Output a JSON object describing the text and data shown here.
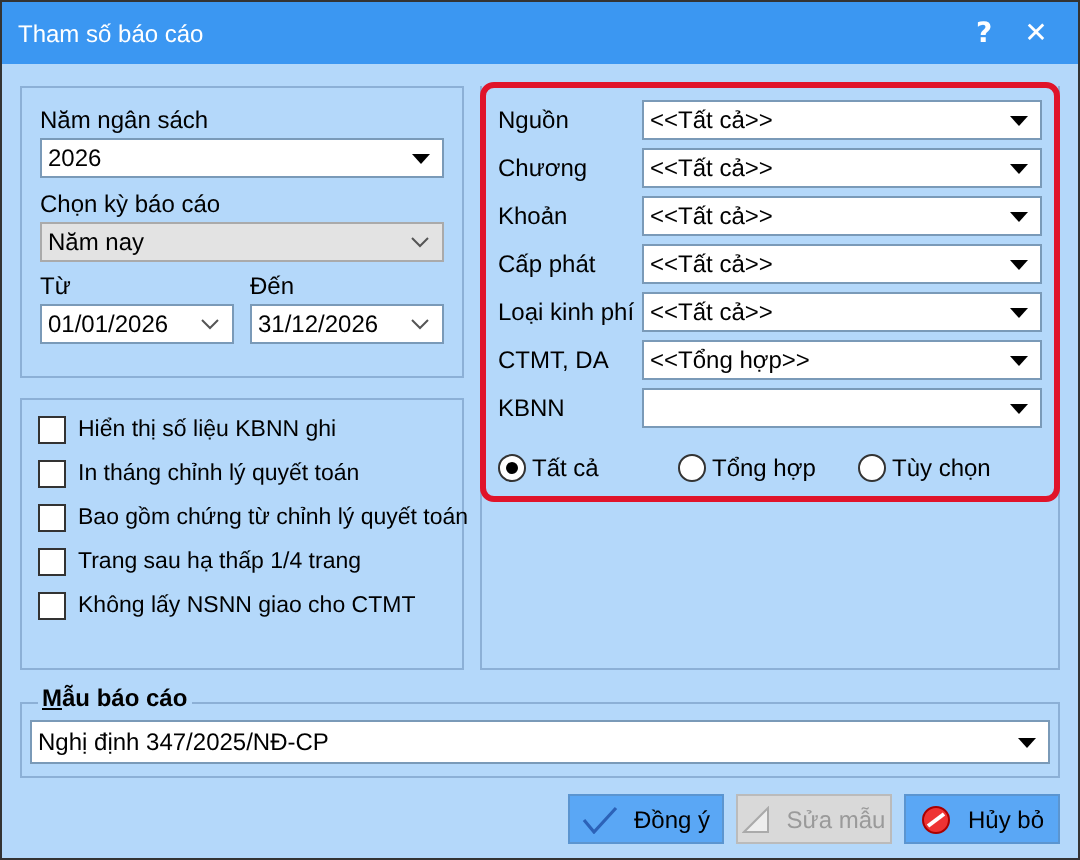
{
  "window": {
    "title": "Tham số báo cáo",
    "help": "?",
    "close": "✕"
  },
  "period": {
    "year_label": "Năm ngân sách",
    "year": "2026",
    "period_label": "Chọn kỳ báo cáo",
    "period": "Năm nay",
    "period_disabled": true,
    "from_label": "Từ",
    "from": "01/01/2026",
    "to_label": "Đến",
    "to": "31/12/2026"
  },
  "options": [
    {
      "label": "Hiển thị số liệu KBNN ghi",
      "checked": false
    },
    {
      "label": "In tháng chỉnh lý quyết toán",
      "checked": false
    },
    {
      "label": "Bao gồm chứng từ chỉnh lý quyết toán",
      "checked": false
    },
    {
      "label": "Trang sau hạ thấp 1/4 trang",
      "checked": false
    },
    {
      "label": "Không lấy NSNN giao cho CTMT",
      "checked": false
    }
  ],
  "filters": [
    {
      "label": "Nguồn",
      "value": "<<Tất cả>>"
    },
    {
      "label": "Chương",
      "value": "<<Tất cả>>"
    },
    {
      "label": "Khoản",
      "value": "<<Tất cả>>"
    },
    {
      "label": "Cấp phát",
      "value": "<<Tất cả>>"
    },
    {
      "label": "Loại kinh phí",
      "value": "<<Tất cả>>"
    },
    {
      "label": "CTMT, DA",
      "value": "<<Tổng hợp>>"
    },
    {
      "label": "KBNN"
    }
  ],
  "modes": [
    {
      "label": "Tất cả",
      "selected": true
    },
    {
      "label": "Tổng hợp",
      "selected": false
    },
    {
      "label": "Tùy chọn",
      "selected": false
    }
  ],
  "template": {
    "label": "Mẫu báo cáo",
    "value": "Nghị định 347/2025/NĐ-CP"
  },
  "buttons": [
    {
      "kind": "ok",
      "label": "Đồng ý",
      "disabled": false
    },
    {
      "kind": "edit",
      "label": "Sửa mẫu",
      "disabled": true
    },
    {
      "kind": "cancel",
      "label": "Hủy bỏ",
      "disabled": false
    }
  ]
}
